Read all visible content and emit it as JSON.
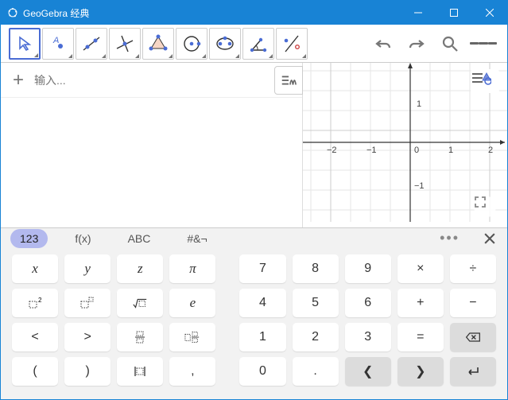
{
  "window": {
    "title": "GeoGebra 经典"
  },
  "input": {
    "placeholder": "输入..."
  },
  "chart_data": {
    "type": "scatter",
    "xlim": [
      -2.5,
      2.5
    ],
    "ylim": [
      -1.8,
      1.5
    ],
    "xticks": [
      -2,
      -1,
      0,
      1,
      2
    ],
    "yticks": [
      -1,
      1
    ],
    "series": []
  },
  "kb": {
    "tabs": {
      "t123": "123",
      "fx": "f(x)",
      "abc": "ABC",
      "sym": "#&¬"
    },
    "row1": {
      "x": "x",
      "y": "y",
      "z": "z",
      "pi": "π",
      "k7": "7",
      "k8": "8",
      "k9": "9",
      "mul": "×",
      "div": "÷"
    },
    "row2": {
      "sq": "⸏²",
      "pw": "⸏⸏",
      "sqrt": "√⸏",
      "e": "e",
      "k4": "4",
      "k5": "5",
      "k6": "6",
      "plus": "+",
      "minus": "−"
    },
    "row3": {
      "lt": "<",
      "gt": ">",
      "fr1": "⣿",
      "fr2": "⣿⸏",
      "k1": "1",
      "k2": "2",
      "k3": "3",
      "eq": "=",
      "bs": "⌫"
    },
    "row4": {
      "lp": "(",
      "rp": ")",
      "br": "⣿",
      "cm": ",",
      "k0": "0",
      "dot": ".",
      "left": "❮",
      "right": "❯",
      "enter": "↵"
    }
  }
}
